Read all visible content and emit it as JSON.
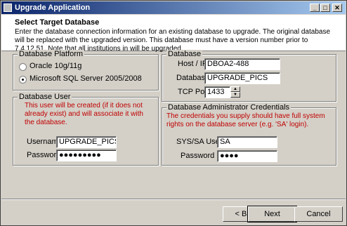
{
  "window": {
    "title": "Upgrade Application",
    "controls": {
      "minimize": "_",
      "maximize": "□",
      "close": "✕"
    }
  },
  "header": {
    "title": "Select Target Database",
    "description": "Enter the database connection information for an existing database to upgrade.  The original database will be replaced with the upgraded version.  This database must have a version number prior to 7.4.12.51.  Note that all institutions in will be upgraded."
  },
  "platform": {
    "legend": "Database Platform",
    "options": [
      {
        "label": "Oracle 10g/11g",
        "selected": false
      },
      {
        "label": "Microsoft SQL Server 2005/2008",
        "selected": true
      }
    ]
  },
  "database": {
    "legend": "Database",
    "host_label": "Host / IP",
    "host_value": "DBOA2-488",
    "db_label": "Database",
    "db_value": "UPGRADE_PICS",
    "port_label": "TCP Port",
    "port_value": "1433"
  },
  "db_user": {
    "legend": "Database User",
    "note": "This user will be created (if it does not already exist) and will associate it with the database.",
    "username_label": "Username",
    "username_value": "UPGRADE_PICS",
    "password_label": "Password",
    "password_value": "●●●●●●●●●"
  },
  "admin": {
    "legend": "Database Administrator Credentials",
    "note": "The credentials you supply should have full system rights on the database server (e.g. 'SA' login).",
    "user_label": "SYS/SA User",
    "user_value": "SA",
    "password_label": "Password",
    "password_value": "●●●●"
  },
  "buttons": {
    "back": "< Back",
    "next": "Next",
    "cancel": "Cancel"
  }
}
